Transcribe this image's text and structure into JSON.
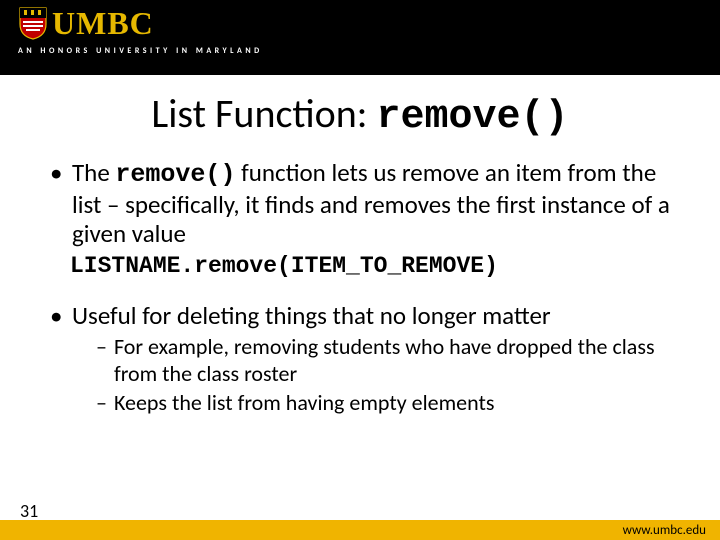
{
  "header": {
    "logo_text": "UMBC",
    "tagline_prefix": "AN HONORS UNIVERSITY",
    "tagline_suffix": "IN MARYLAND"
  },
  "title": {
    "prefix": "List Function: ",
    "code": "remove()"
  },
  "bullets": [
    {
      "parts": [
        {
          "text": "The ",
          "mono": false
        },
        {
          "text": "remove()",
          "mono": true
        },
        {
          "text": "  function lets us remove an item from the list – specifically, it finds and removes the first instance of a given value",
          "mono": false
        }
      ],
      "code_after": "LISTNAME.remove(ITEM_TO_REMOVE)"
    },
    {
      "parts": [
        {
          "text": "Useful for deleting things that no longer matter",
          "mono": false
        }
      ],
      "sub": [
        "For example, removing students who have dropped the class from the class roster",
        "Keeps the list from having empty elements"
      ]
    }
  ],
  "footer": {
    "page_number": "31",
    "url": "www.umbc.edu"
  }
}
